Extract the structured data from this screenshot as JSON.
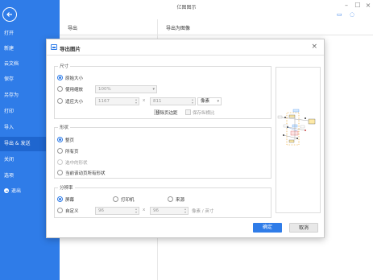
{
  "window": {
    "title": "亿图图示"
  },
  "sidebar": {
    "items": [
      {
        "label": "打开"
      },
      {
        "label": "新建"
      },
      {
        "label": "云文档"
      },
      {
        "label": "保存"
      },
      {
        "label": "另存为"
      },
      {
        "label": "打印"
      },
      {
        "label": "导入"
      },
      {
        "label": "导出 & 发送",
        "active": true
      },
      {
        "label": "关闭"
      },
      {
        "label": "选项"
      },
      {
        "label": "退出"
      }
    ]
  },
  "main": {
    "left_header": "导出",
    "right_header": "导出为图像"
  },
  "dialog": {
    "title": "导出图片",
    "size": {
      "label": "尺寸",
      "original": "原始大小",
      "scale": "使用缩放",
      "scale_value": "100%",
      "fit": "适应大小",
      "width": "1167",
      "x": "x",
      "height": "811",
      "unit": "像素",
      "remove_margin": "移除页边距",
      "keep_ratio": "保存纵横比"
    },
    "shape": {
      "label": "形状",
      "whole_page": "整页",
      "all_pages": "所有页",
      "selected": "选中的形状",
      "current_page_all": "当前该动页所有形状"
    },
    "resolution": {
      "label": "分辨率",
      "screen": "屏幕",
      "printer": "打印机",
      "source": "来源",
      "custom": "自定义",
      "dpi_x": "96",
      "x": "x",
      "dpi_y": "96",
      "unit": "像素 / 英寸"
    },
    "ok": "确定",
    "cancel": "取消"
  },
  "colors": {
    "accent": "#2f7ce8",
    "sidebar": "#2f7ce8",
    "active": "#1f66cf"
  }
}
